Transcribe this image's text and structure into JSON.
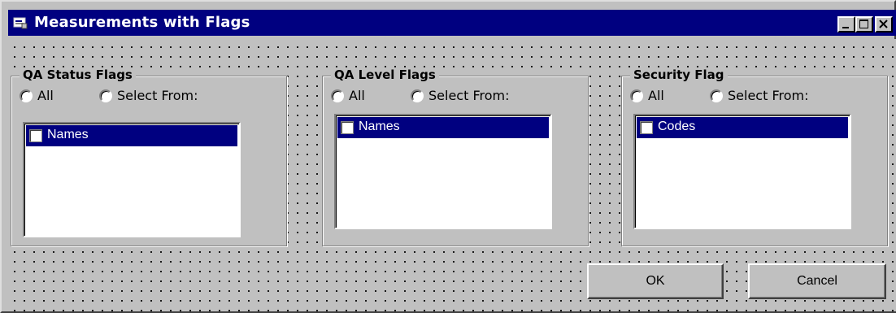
{
  "window": {
    "title": "Measurements with Flags",
    "controls": {
      "minimize": "_",
      "maximize": "□",
      "close": "×"
    }
  },
  "groups": [
    {
      "label": "QA Status Flags",
      "radio_all": "All",
      "radio_select": "Select From:",
      "list_item": "Names"
    },
    {
      "label": "QA Level Flags",
      "radio_all": "All",
      "radio_select": "Select From:",
      "list_item": "Names"
    },
    {
      "label": "Security Flag",
      "radio_all": "All",
      "radio_select": "Select From:",
      "list_item": "Codes"
    }
  ],
  "buttons": {
    "ok": "OK",
    "cancel": "Cancel"
  },
  "colors": {
    "titlebar": "#000080",
    "face": "#c0c0c0",
    "selection": "#000080"
  }
}
